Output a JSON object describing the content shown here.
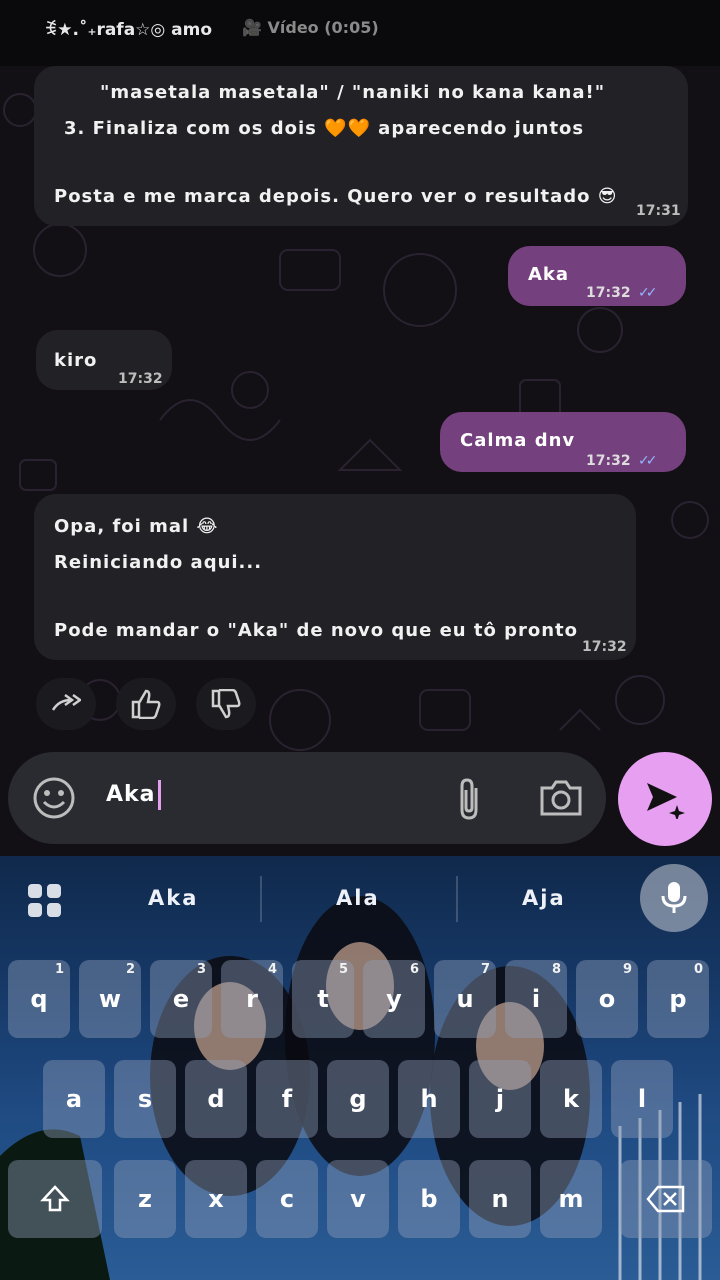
{
  "status_bar": {
    "title": "ꉂ★.˚₊rafa☆◎ amo",
    "video_label": "🎥 Vídeo (0:05)"
  },
  "messages": [
    {
      "dir": "in",
      "lines": [
        "\"masetala masetala\" / \"naniki no kana kana!\"",
        "3.  Finaliza com os dois 🧡🧡 aparecendo juntos",
        "",
        "Posta e me marca depois. Quero ver o resultado 😎"
      ],
      "time": "17:31"
    },
    {
      "dir": "out",
      "lines": [
        "Aka"
      ],
      "time": "17:32"
    },
    {
      "dir": "in",
      "lines": [
        "kiro"
      ],
      "time": "17:32"
    },
    {
      "dir": "out",
      "lines": [
        "Calma dnv"
      ],
      "time": "17:32"
    },
    {
      "dir": "in",
      "lines": [
        "Opa, foi mal 😂",
        "Reiniciando aqui...",
        "",
        "Pode mandar o \"Aka\" de novo que eu tô pronto"
      ],
      "time": "17:32"
    }
  ],
  "actions": {
    "forward": "forward-icon",
    "like": "thumbs-up-icon",
    "dislike": "thumbs-down-icon"
  },
  "input": {
    "value": "Aka"
  },
  "keyboard": {
    "suggestions": [
      "Aka",
      "Ala",
      "Aja"
    ],
    "row1": [
      "q",
      "w",
      "e",
      "r",
      "t",
      "y",
      "u",
      "i",
      "o",
      "p"
    ],
    "row1_nums": [
      "1",
      "2",
      "3",
      "4",
      "5",
      "6",
      "7",
      "8",
      "9",
      "0"
    ],
    "row2": [
      "a",
      "s",
      "d",
      "f",
      "g",
      "h",
      "j",
      "k",
      "l"
    ],
    "row3": [
      "z",
      "x",
      "c",
      "v",
      "b",
      "n",
      "m"
    ]
  },
  "colors": {
    "outgoing": "#74407d",
    "incoming": "#222126",
    "send_button": "#e79ff1",
    "ticks": "#8fb7ff"
  }
}
